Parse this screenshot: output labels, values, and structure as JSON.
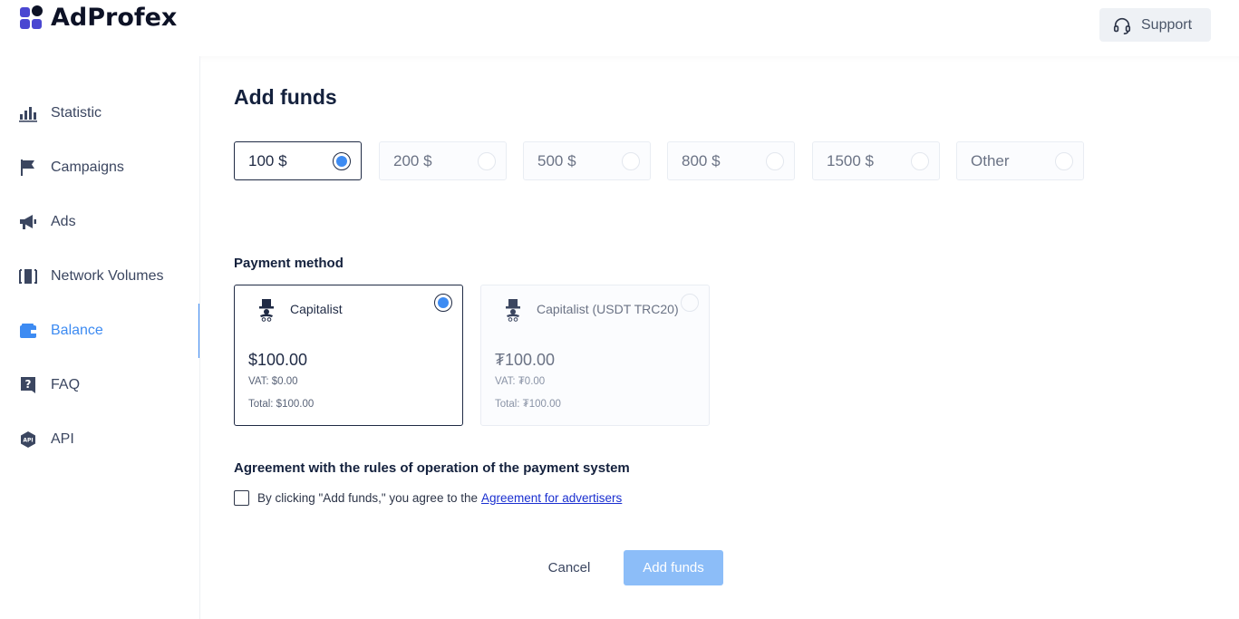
{
  "app": {
    "logo_text": "AdProfex"
  },
  "header": {
    "support_label": "Support"
  },
  "sidebar": {
    "items": [
      {
        "label": "Statistic",
        "icon": "bar-chart-icon",
        "active": false
      },
      {
        "label": "Campaigns",
        "icon": "flag-icon",
        "active": false
      },
      {
        "label": "Ads",
        "icon": "megaphone-icon",
        "active": false
      },
      {
        "label": "Network Volumes",
        "icon": "network-volumes-icon",
        "active": false
      },
      {
        "label": "Balance",
        "icon": "wallet-icon",
        "active": true
      },
      {
        "label": "FAQ",
        "icon": "question-icon",
        "active": false
      },
      {
        "label": "API",
        "icon": "api-icon",
        "active": false
      }
    ]
  },
  "main": {
    "title": "Add funds",
    "amounts": [
      {
        "label": "100 $",
        "selected": true
      },
      {
        "label": "200 $",
        "selected": false
      },
      {
        "label": "500 $",
        "selected": false
      },
      {
        "label": "800 $",
        "selected": false
      },
      {
        "label": "1500 $",
        "selected": false
      },
      {
        "label": "Other",
        "selected": false
      }
    ],
    "payment_method_label": "Payment method",
    "payment_methods": [
      {
        "name": "Capitalist",
        "amount": "$100.00",
        "vat": "VAT: $0.00",
        "total": "Total: $100.00",
        "selected": true,
        "icon": "capitalist-icon"
      },
      {
        "name": "Capitalist (USDT TRC20)",
        "amount": "₮100.00",
        "vat": "VAT: ₮0.00",
        "total": "Total: ₮100.00",
        "selected": false,
        "icon": "capitalist-icon"
      }
    ],
    "agreement_heading": "Agreement with the rules of operation of the payment system",
    "agreement_text": "By clicking \"Add funds,\" you agree to the",
    "agreement_link": "Agreement for advertisers",
    "agreement_checked": false,
    "cancel_label": "Cancel",
    "submit_label": "Add funds"
  },
  "colors": {
    "accent": "#3d8bf2",
    "submit_disabled": "#8cbdf8",
    "logo_purple": "#4a47d1",
    "text_dark": "#14213d"
  }
}
